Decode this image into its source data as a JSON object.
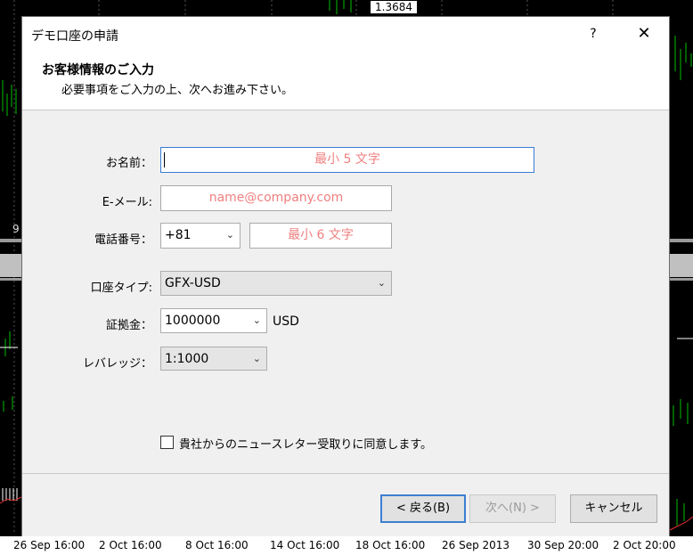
{
  "chart": {
    "price_tag": "1.3684",
    "left_number": "9",
    "time_labels": [
      "26 Sep 16:00",
      "2 Oct 16:00",
      "8 Oct 16:00",
      "14 Oct 16:00",
      "18 Oct 16:00",
      "26 Sep 2013",
      "30 Sep 20:00",
      "2 Oct 20:00"
    ]
  },
  "dialog": {
    "title": "デモ口座の申請",
    "help": "?",
    "close": "✕",
    "heading": "お客様情報のご入力",
    "subheading": "必要事項をご入力の上、次へお進み下さい。"
  },
  "form": {
    "name_label": "お名前：",
    "name_placeholder": "最小 5 文字",
    "email_label": "E-メール:",
    "email_placeholder": "name@company.com",
    "phone_label": "電話番号：",
    "phone_code": "+81",
    "phone_placeholder": "最小 6 文字",
    "account_type_label": "口座タイプ:",
    "account_type_value": "GFX-USD",
    "deposit_label": "証拠金：",
    "deposit_value": "1000000",
    "deposit_unit": "USD",
    "leverage_label": "レバレッジ：",
    "leverage_value": "1:1000",
    "newsletter_label": "貴社からのニュースレター受取りに同意します。",
    "newsletter_checked": false
  },
  "buttons": {
    "back": "< 戻る(B)",
    "next": "次へ(N) >",
    "cancel": "キャンセル"
  },
  "colors": {
    "placeholder": "#f08080",
    "focus_border": "#3a7bd5",
    "chart_green": "#00c000"
  }
}
